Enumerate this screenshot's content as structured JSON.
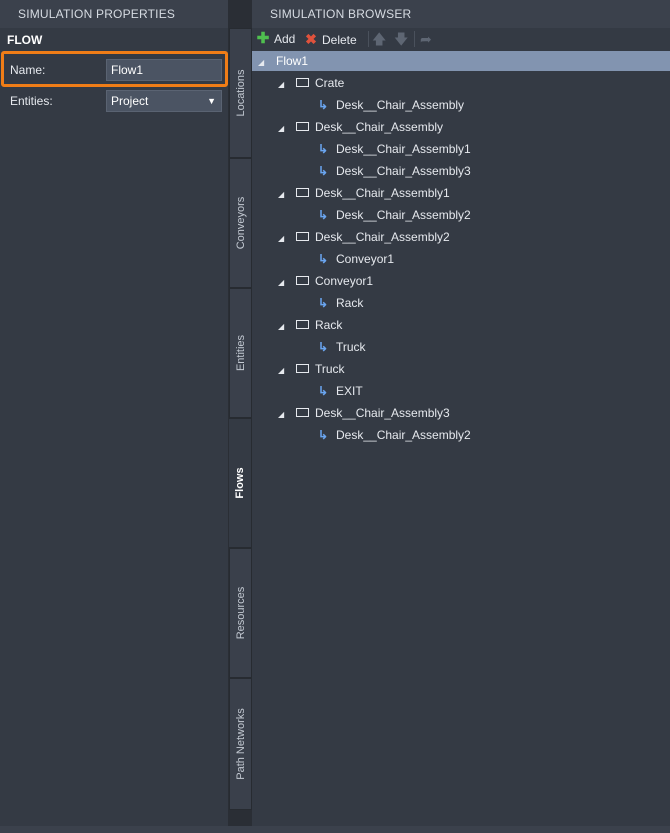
{
  "left_panel": {
    "header": "SIMULATION PROPERTIES",
    "section_title": "FLOW",
    "name_label": "Name:",
    "name_value": "Flow1",
    "entities_label": "Entities:",
    "entities_value": "Project"
  },
  "tabs": [
    {
      "label": "Locations",
      "active": false
    },
    {
      "label": "Conveyors",
      "active": false
    },
    {
      "label": "Entities",
      "active": false
    },
    {
      "label": "Flows",
      "active": true
    },
    {
      "label": "Resources",
      "active": false
    },
    {
      "label": "Path Networks",
      "active": false
    }
  ],
  "right_panel": {
    "header": "SIMULATION BROWSER",
    "toolbar": {
      "add_label": "Add",
      "delete_label": "Delete"
    },
    "tree": [
      {
        "label": "Flow1",
        "level": 0,
        "kind": "root",
        "selected": true
      },
      {
        "label": "Crate",
        "level": 1,
        "kind": "location"
      },
      {
        "label": "Desk__Chair_Assembly",
        "level": 2,
        "kind": "flow"
      },
      {
        "label": "Desk__Chair_Assembly",
        "level": 1,
        "kind": "location"
      },
      {
        "label": "Desk__Chair_Assembly1",
        "level": 2,
        "kind": "flow"
      },
      {
        "label": "Desk__Chair_Assembly3",
        "level": 2,
        "kind": "flow"
      },
      {
        "label": "Desk__Chair_Assembly1",
        "level": 1,
        "kind": "location"
      },
      {
        "label": "Desk__Chair_Assembly2",
        "level": 2,
        "kind": "flow"
      },
      {
        "label": "Desk__Chair_Assembly2",
        "level": 1,
        "kind": "location"
      },
      {
        "label": "Conveyor1",
        "level": 2,
        "kind": "flow"
      },
      {
        "label": "Conveyor1",
        "level": 1,
        "kind": "location"
      },
      {
        "label": "Rack",
        "level": 2,
        "kind": "flow"
      },
      {
        "label": "Rack",
        "level": 1,
        "kind": "location"
      },
      {
        "label": "Truck",
        "level": 2,
        "kind": "flow"
      },
      {
        "label": "Truck",
        "level": 1,
        "kind": "location"
      },
      {
        "label": "EXIT",
        "level": 2,
        "kind": "flow"
      },
      {
        "label": "Desk__Chair_Assembly3",
        "level": 1,
        "kind": "location"
      },
      {
        "label": "Desk__Chair_Assembly2",
        "level": 2,
        "kind": "flow"
      }
    ]
  },
  "colors": {
    "highlight": "#f07d17",
    "selection": "#8294b0",
    "add_icon": "#4fc04f",
    "delete_icon": "#e0523c",
    "flow_arrow": "#6aa5f0"
  },
  "icons": {
    "add": "plus-icon",
    "delete": "x-icon",
    "move_up": "arrow-up-icon",
    "move_down": "arrow-down-icon",
    "redirect": "redirect-arrow-icon"
  }
}
